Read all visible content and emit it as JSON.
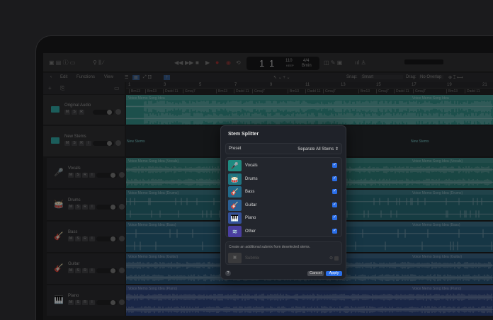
{
  "toolbar": {
    "counter_bar": "1",
    "counter_beat": "1",
    "tempo": "110",
    "tempo_label": "KEEP",
    "time_signature": "4/4",
    "key": "Bmin"
  },
  "edit_bar": {
    "edit": "Edit",
    "functions": "Functions",
    "view": "View",
    "snap_label": "Snap:",
    "snap_value": "Smart",
    "drag_label": "Drag:",
    "drag_value": "No Overlap"
  },
  "ruler": [
    "1",
    "3",
    "5",
    "7",
    "9",
    "11",
    "13",
    "15",
    "17",
    "19",
    "21"
  ],
  "chords": [
    "Bm13",
    "Bm13",
    "Dadd 11",
    "Gmaj7",
    "Bm13",
    "Dadd 11",
    "Gmaj7",
    "Bm13",
    "Dadd 11",
    "Gmaj7",
    "Bm13",
    "Gmaj7",
    "Dadd 11",
    "Gmaj7",
    "Bm13",
    "Dadd 11"
  ],
  "tracks": [
    {
      "name": "Original Audio",
      "buttons": [
        "M",
        "S",
        "R"
      ],
      "color": "#2d7c76",
      "region": "Voice Memo Song Idea",
      "icon": "audio-icon"
    },
    {
      "name": "New Stems",
      "buttons": [
        "M",
        "S",
        "R",
        "I"
      ],
      "color": "#1f2326",
      "region": "New Stems",
      "icon": "folder-icon"
    },
    {
      "name": "Vocals",
      "buttons": [
        "M",
        "S",
        "R",
        "I"
      ],
      "color": "#276c68",
      "region": "Voice Memo Song Idea (Vocals)",
      "icon": "microphone-icon"
    },
    {
      "name": "Drums",
      "buttons": [
        "M",
        "S",
        "R",
        "I"
      ],
      "color": "#235c66",
      "region": "Voice Memo Song Idea (Drums)",
      "icon": "drums-icon"
    },
    {
      "name": "Bass",
      "buttons": [
        "M",
        "S",
        "R",
        "I"
      ],
      "color": "#23536a",
      "region": "Voice Memo Song Idea (Bass)",
      "icon": "bass-icon"
    },
    {
      "name": "Guitar",
      "buttons": [
        "M",
        "S",
        "R",
        "I"
      ],
      "color": "#234866",
      "region": "Voice Memo Song Idea (Guitar)",
      "icon": "guitar-icon"
    },
    {
      "name": "Piano",
      "buttons": [
        "M",
        "S",
        "R",
        "I"
      ],
      "color": "#273b6c",
      "region": "Voice Memo Song Idea (Piano)",
      "icon": "piano-icon"
    }
  ],
  "dialog": {
    "title": "Stem Splitter",
    "preset_label": "Preset",
    "preset_value": "Separate All Stems",
    "stems": [
      {
        "label": "Vocals",
        "checked": true,
        "color": "#1f8a80",
        "icon": "microphone-icon",
        "glyph": "🎤"
      },
      {
        "label": "Drums",
        "checked": true,
        "color": "#1f7480",
        "icon": "drums-icon",
        "glyph": "🥁"
      },
      {
        "label": "Bass",
        "checked": true,
        "color": "#226a8a",
        "icon": "bass-icon",
        "glyph": "🎸"
      },
      {
        "label": "Guitar",
        "checked": true,
        "color": "#2a5f94",
        "icon": "guitar-icon",
        "glyph": "🎸"
      },
      {
        "label": "Piano",
        "checked": true,
        "color": "#34519a",
        "icon": "piano-icon",
        "glyph": "🎹"
      },
      {
        "label": "Other",
        "checked": true,
        "color": "#4a3ea0",
        "icon": "waveform-icon",
        "glyph": "≋"
      }
    ],
    "submix_hint": "Create an additional submix from deselected stems.",
    "submix_label": "Submix",
    "help": "?",
    "cancel": "Cancel",
    "apply": "Apply",
    "accent": "#2a6ee8"
  }
}
